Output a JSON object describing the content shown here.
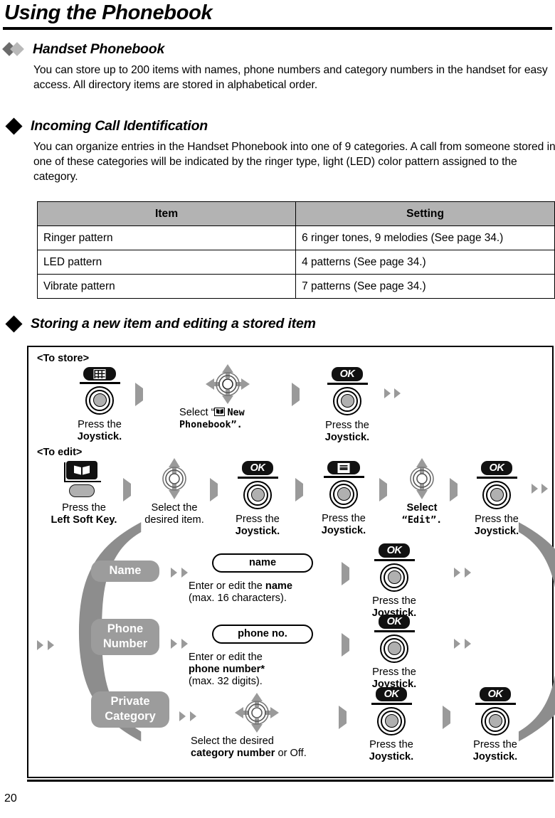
{
  "page": {
    "title": "Using the Phonebook",
    "number": "20"
  },
  "sections": [
    {
      "heading": "Handset Phonebook",
      "bullet": "double-diamond",
      "body": "You can store up to 200 items with names, phone numbers and category numbers in the handset for easy access. All directory items are stored in alphabetical order."
    },
    {
      "heading": "Incoming Call Identification",
      "bullet": "single-diamond",
      "body": "You can organize entries in the Handset Phonebook into one of 9 categories. A call from someone stored in one of these categories will be indicated by the ringer type, light (LED) color pattern assigned to the category."
    },
    {
      "heading": "Storing a new item and editing a stored item",
      "bullet": "single-diamond",
      "body": ""
    }
  ],
  "table": {
    "headers": [
      "Item",
      "Setting"
    ],
    "rows": [
      [
        "Ringer pattern",
        "6 ringer tones, 9 melodies (See page 34.)"
      ],
      [
        "LED pattern",
        "4 patterns (See page 34.)"
      ],
      [
        "Vibrate pattern",
        "7 patterns (See page 34.)"
      ]
    ]
  },
  "flow": {
    "store_label": "<To store>",
    "edit_label": "<To edit>",
    "store_steps": [
      {
        "icon": "keypad-key-icon",
        "line1": "Press the",
        "line2": "Joystick."
      },
      {
        "icon": "joystick-4way-icon",
        "line1": "Select “",
        "line2": "New",
        "line3": "Phonebook”."
      },
      {
        "icon": "ok-key-icon",
        "line1": "Press the",
        "line2": "Joystick."
      }
    ],
    "edit_steps": [
      {
        "icon": "left-soft-key-icon",
        "line1": "Press the",
        "line2": "Left Soft Key."
      },
      {
        "icon": "joystick-2way-icon",
        "line1": "Select the",
        "line2": "desired item."
      },
      {
        "icon": "ok-key-icon",
        "line1": "Press the",
        "line2": "Joystick."
      },
      {
        "icon": "menu-key-icon",
        "line1": "Press the",
        "line2": "Joystick."
      },
      {
        "icon": "joystick-2way-icon",
        "line1": "Select",
        "line2": "“Edit”.",
        "mono2": true
      },
      {
        "icon": "ok-key-icon",
        "line1": "Press the",
        "line2": "Joystick."
      }
    ],
    "fields": [
      {
        "pill": "Name",
        "entry": "name",
        "desc_line1_pre": "Enter or edit the ",
        "desc_line1_b": "name",
        "desc_line2": "(max. 16 characters).",
        "press_line1": "Press the",
        "press_line2": "Joystick."
      },
      {
        "pill_line1": "Phone",
        "pill_line2": "Number",
        "entry": "phone no.",
        "desc_line1": "Enter or edit the",
        "desc_line2_b": "phone number*",
        "desc_line3": "(max. 32 digits).",
        "press_line1": "Press the",
        "press_line2": "Joystick."
      },
      {
        "pill_line1": "Private",
        "pill_line2": "Category",
        "entry": "",
        "desc_line1": "Select the desired",
        "desc_line2_b": "category number",
        "desc_line2_post": " or Off.",
        "press_line1": "Press the",
        "press_line2": "Joystick.",
        "press2_line1": "Press the",
        "press2_line2": "Joystick."
      }
    ],
    "ok_label": "OK"
  },
  "colors": {
    "table_header_bg": "#b3b3b3",
    "pill_gray": "#9c9c9c",
    "arrow_gray": "#9a9a9a",
    "key_black": "#111111",
    "diamond_dark": "#6b6b6b",
    "diamond_light": "#b9b9b9"
  }
}
